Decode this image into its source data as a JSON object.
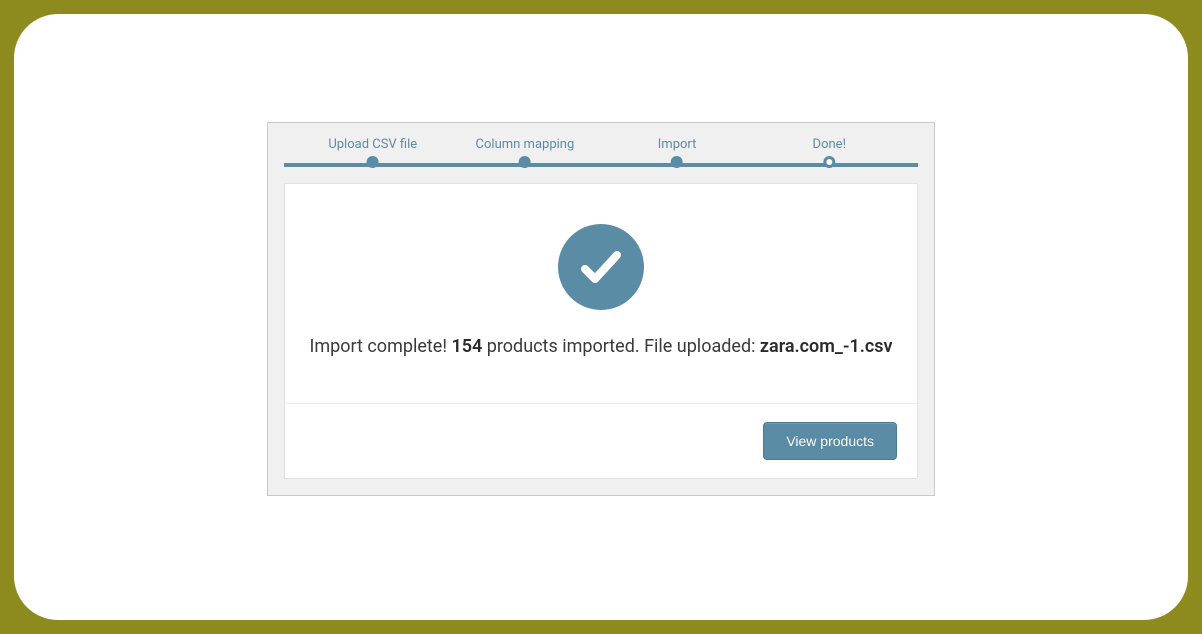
{
  "stepper": {
    "steps": [
      {
        "label": "Upload CSV file",
        "pos": 14,
        "state": "done"
      },
      {
        "label": "Column mapping",
        "pos": 38,
        "state": "done"
      },
      {
        "label": "Import",
        "pos": 62,
        "state": "done"
      },
      {
        "label": "Done!",
        "pos": 86,
        "state": "current"
      }
    ]
  },
  "result": {
    "prefix": "Import complete! ",
    "count": "154",
    "mid": " products imported. File uploaded: ",
    "filename": "zara.com_-1.csv"
  },
  "footer": {
    "view_button": "View products"
  },
  "colors": {
    "accent": "#5b8ca5",
    "outer_bg": "#8d8b1e"
  }
}
